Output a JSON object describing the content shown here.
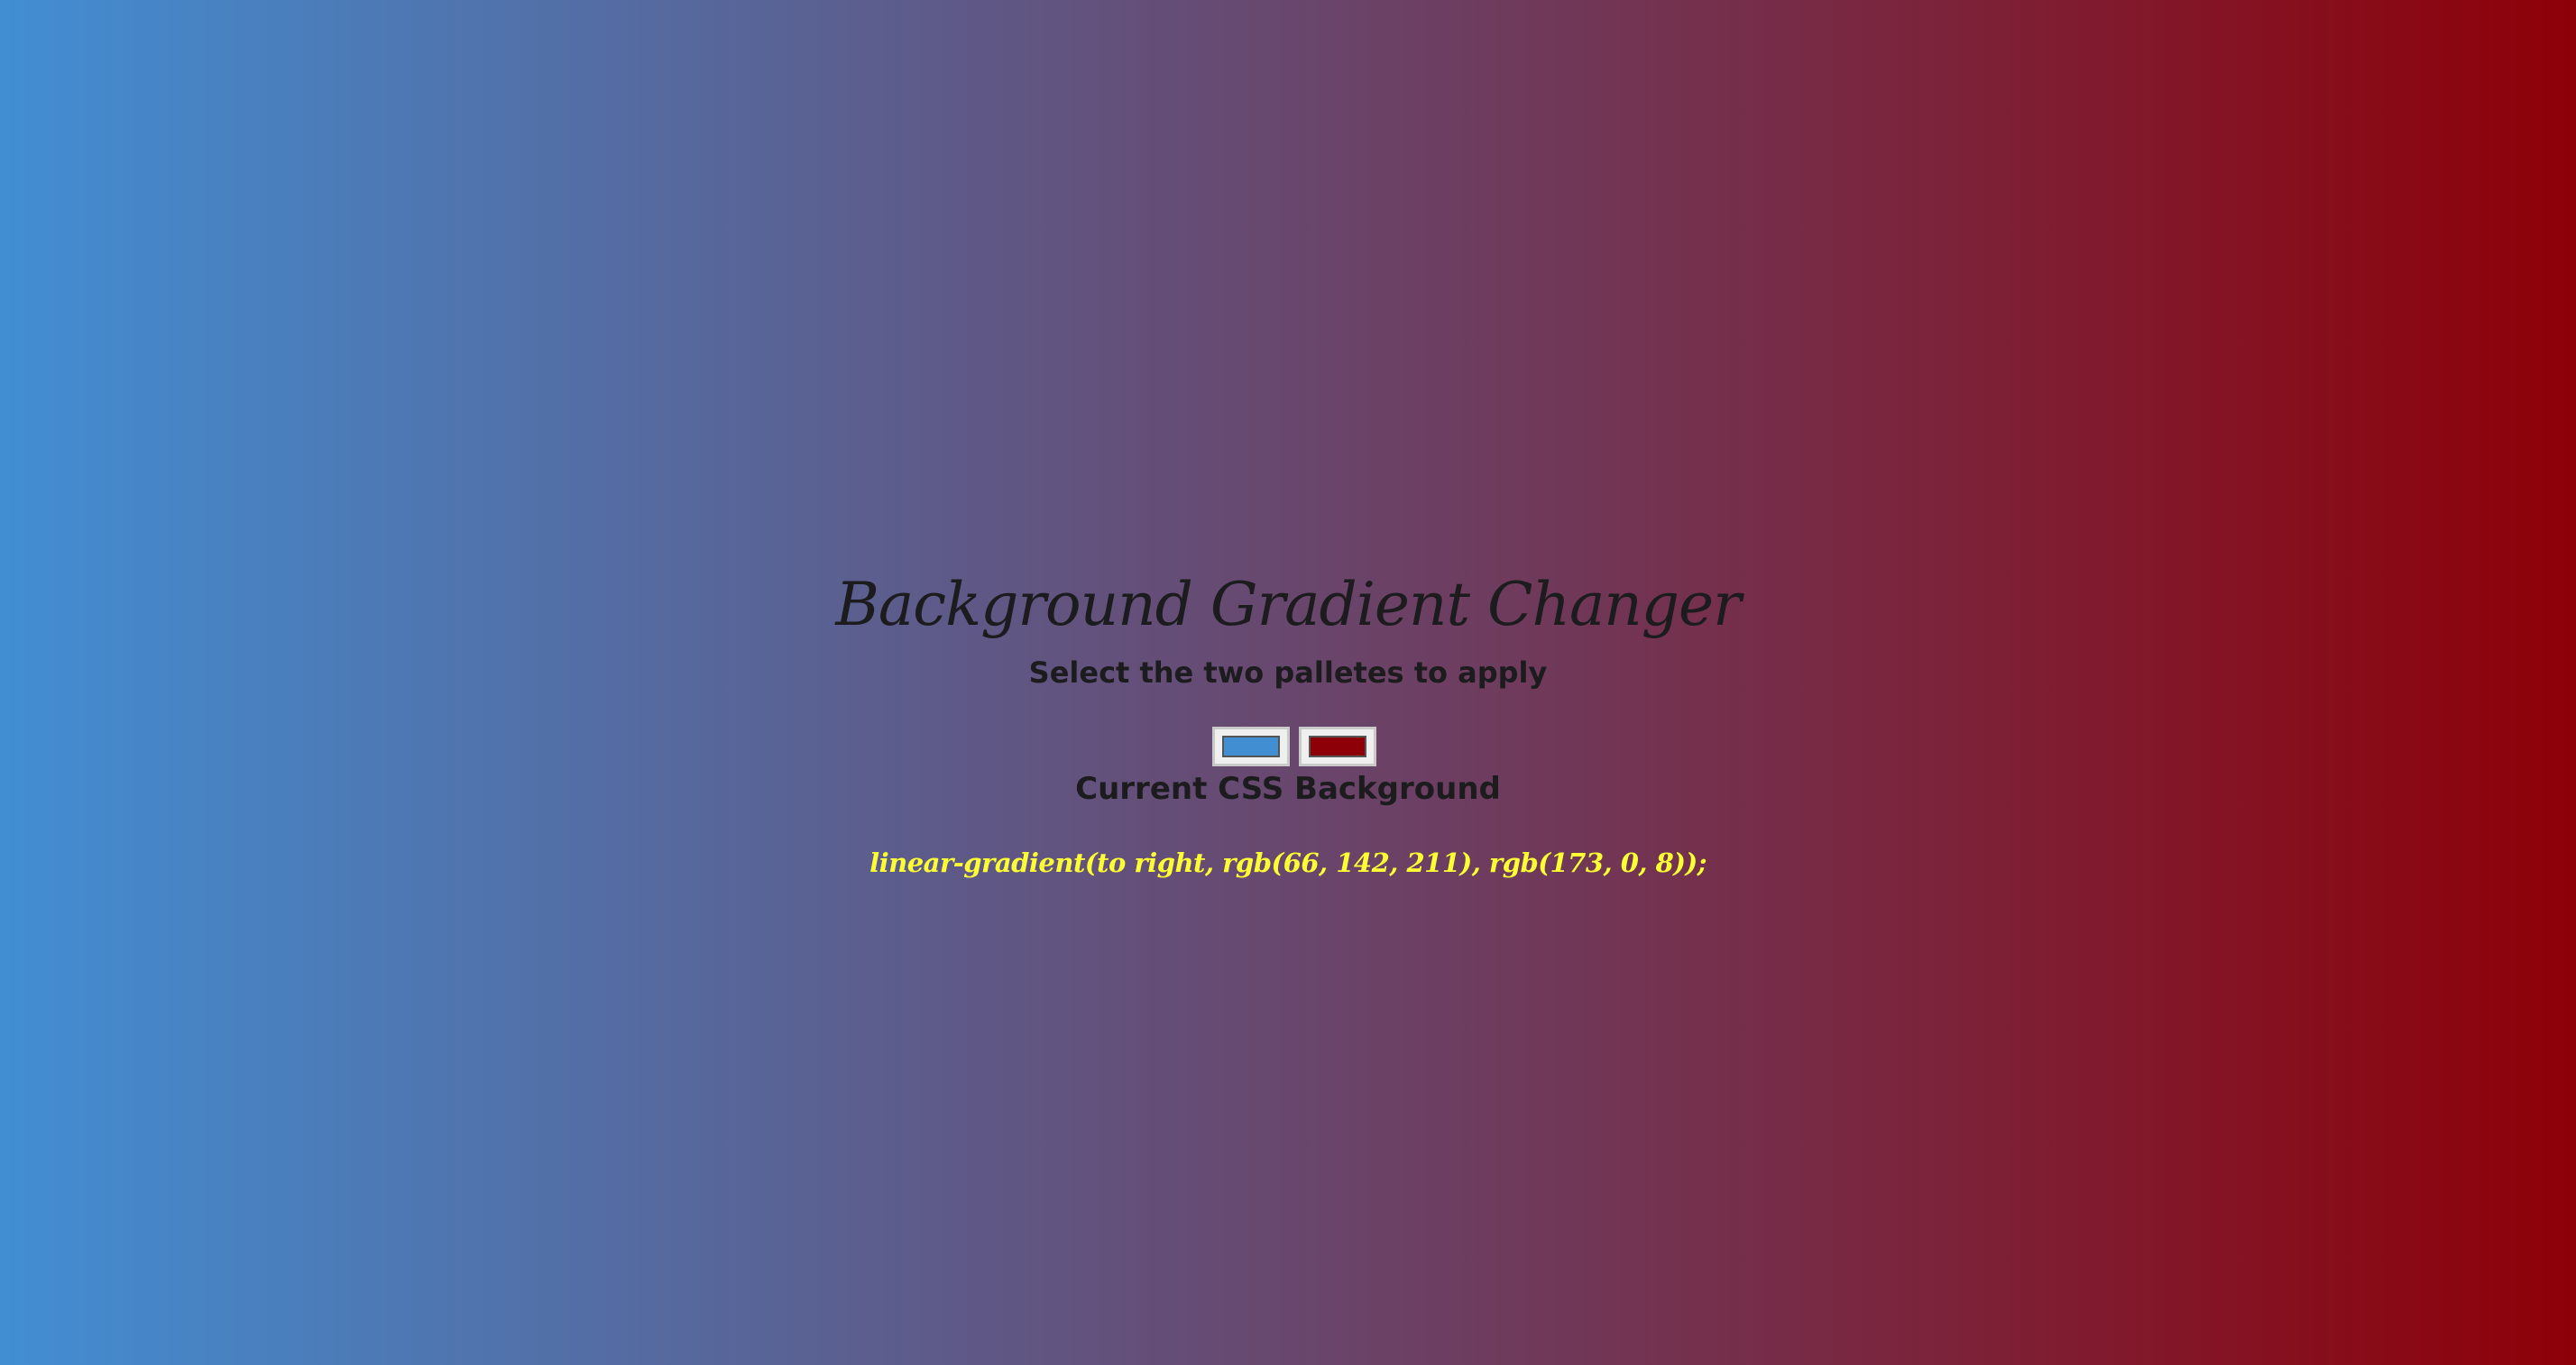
{
  "page": {
    "title": "Background Gradient Changer",
    "subtitle": "Select the two palletes to apply",
    "current_heading": "Current CSS Background",
    "css_output": "linear-gradient(to right, rgb(66, 142, 211), rgb(173, 0, 8));"
  },
  "colors": {
    "color1": "#428ed3",
    "color2": "#8e0008",
    "text_dark": "#1c1c1e",
    "css_text": "#ffff33"
  },
  "pickers": [
    {
      "name": "color-picker-1",
      "value": "#428ed3"
    },
    {
      "name": "color-picker-2",
      "value": "#8e0008"
    }
  ]
}
